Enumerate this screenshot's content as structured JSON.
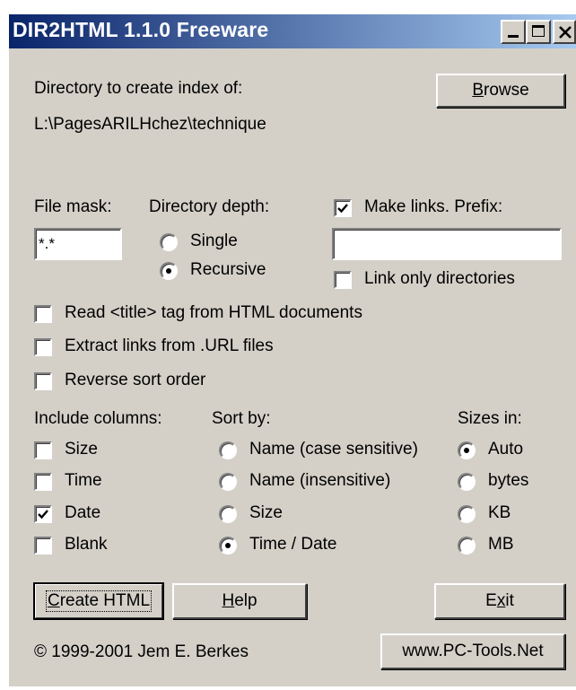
{
  "window": {
    "title": "DIR2HTML 1.1.0 Freeware",
    "controls": {
      "minimize": "minimize-icon",
      "maximize": "maximize-icon",
      "close": "close-icon"
    }
  },
  "directory": {
    "label": "Directory to create index of:",
    "path": "L:\\PagesARILHchez\\technique",
    "browse": {
      "pre": "",
      "mnemonic": "B",
      "post": "rowse"
    }
  },
  "file_mask": {
    "label": "File mask:",
    "value": "*.*"
  },
  "directory_depth": {
    "label": "Directory depth:",
    "options": [
      "Single",
      "Recursive"
    ],
    "selected": "Recursive"
  },
  "links": {
    "make_links_label": "Make links. Prefix:",
    "make_links_checked": true,
    "prefix_value": "",
    "link_only_dirs_label": "Link only directories",
    "link_only_dirs_checked": false
  },
  "options": [
    {
      "label": "Read <title> tag from HTML documents",
      "checked": false
    },
    {
      "label": "Extract links from .URL files",
      "checked": false
    },
    {
      "label": "Reverse sort order",
      "checked": false
    }
  ],
  "columns": {
    "label": "Include columns:",
    "items": [
      {
        "label": "Size",
        "checked": false
      },
      {
        "label": "Time",
        "checked": false
      },
      {
        "label": "Date",
        "checked": true
      },
      {
        "label": "Blank",
        "checked": false
      }
    ]
  },
  "sort_by": {
    "label": "Sort by:",
    "options": [
      "Name (case sensitive)",
      "Name (insensitive)",
      "Size",
      "Time / Date"
    ],
    "selected": "Time / Date"
  },
  "sizes_in": {
    "label": "Sizes in:",
    "options": [
      "Auto",
      "bytes",
      "KB",
      "MB"
    ],
    "selected": "Auto"
  },
  "buttons": {
    "create": {
      "mnemonic": "C",
      "post": "reate HTML"
    },
    "help": {
      "mnemonic": "H",
      "post": "elp"
    },
    "exit": {
      "pre": "E",
      "mnemonic": "x",
      "post": "it"
    },
    "website": "www.PC-Tools.Net"
  },
  "copyright": "© 1999-2001 Jem E. Berkes",
  "colors": {
    "face": "#d4d0c8",
    "title_start": "#0a246a",
    "title_end": "#a6caf0"
  }
}
